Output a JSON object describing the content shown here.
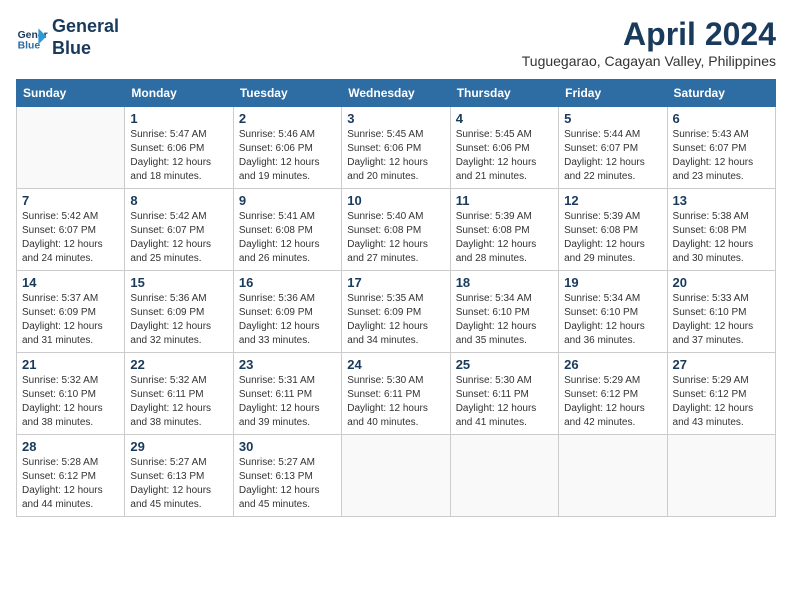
{
  "header": {
    "logo_line1": "General",
    "logo_line2": "Blue",
    "month_title": "April 2024",
    "location": "Tuguegarao, Cagayan Valley, Philippines"
  },
  "weekdays": [
    "Sunday",
    "Monday",
    "Tuesday",
    "Wednesday",
    "Thursday",
    "Friday",
    "Saturday"
  ],
  "weeks": [
    [
      {
        "day": "",
        "info": ""
      },
      {
        "day": "1",
        "info": "Sunrise: 5:47 AM\nSunset: 6:06 PM\nDaylight: 12 hours\nand 18 minutes."
      },
      {
        "day": "2",
        "info": "Sunrise: 5:46 AM\nSunset: 6:06 PM\nDaylight: 12 hours\nand 19 minutes."
      },
      {
        "day": "3",
        "info": "Sunrise: 5:45 AM\nSunset: 6:06 PM\nDaylight: 12 hours\nand 20 minutes."
      },
      {
        "day": "4",
        "info": "Sunrise: 5:45 AM\nSunset: 6:06 PM\nDaylight: 12 hours\nand 21 minutes."
      },
      {
        "day": "5",
        "info": "Sunrise: 5:44 AM\nSunset: 6:07 PM\nDaylight: 12 hours\nand 22 minutes."
      },
      {
        "day": "6",
        "info": "Sunrise: 5:43 AM\nSunset: 6:07 PM\nDaylight: 12 hours\nand 23 minutes."
      }
    ],
    [
      {
        "day": "7",
        "info": "Sunrise: 5:42 AM\nSunset: 6:07 PM\nDaylight: 12 hours\nand 24 minutes."
      },
      {
        "day": "8",
        "info": "Sunrise: 5:42 AM\nSunset: 6:07 PM\nDaylight: 12 hours\nand 25 minutes."
      },
      {
        "day": "9",
        "info": "Sunrise: 5:41 AM\nSunset: 6:08 PM\nDaylight: 12 hours\nand 26 minutes."
      },
      {
        "day": "10",
        "info": "Sunrise: 5:40 AM\nSunset: 6:08 PM\nDaylight: 12 hours\nand 27 minutes."
      },
      {
        "day": "11",
        "info": "Sunrise: 5:39 AM\nSunset: 6:08 PM\nDaylight: 12 hours\nand 28 minutes."
      },
      {
        "day": "12",
        "info": "Sunrise: 5:39 AM\nSunset: 6:08 PM\nDaylight: 12 hours\nand 29 minutes."
      },
      {
        "day": "13",
        "info": "Sunrise: 5:38 AM\nSunset: 6:08 PM\nDaylight: 12 hours\nand 30 minutes."
      }
    ],
    [
      {
        "day": "14",
        "info": "Sunrise: 5:37 AM\nSunset: 6:09 PM\nDaylight: 12 hours\nand 31 minutes."
      },
      {
        "day": "15",
        "info": "Sunrise: 5:36 AM\nSunset: 6:09 PM\nDaylight: 12 hours\nand 32 minutes."
      },
      {
        "day": "16",
        "info": "Sunrise: 5:36 AM\nSunset: 6:09 PM\nDaylight: 12 hours\nand 33 minutes."
      },
      {
        "day": "17",
        "info": "Sunrise: 5:35 AM\nSunset: 6:09 PM\nDaylight: 12 hours\nand 34 minutes."
      },
      {
        "day": "18",
        "info": "Sunrise: 5:34 AM\nSunset: 6:10 PM\nDaylight: 12 hours\nand 35 minutes."
      },
      {
        "day": "19",
        "info": "Sunrise: 5:34 AM\nSunset: 6:10 PM\nDaylight: 12 hours\nand 36 minutes."
      },
      {
        "day": "20",
        "info": "Sunrise: 5:33 AM\nSunset: 6:10 PM\nDaylight: 12 hours\nand 37 minutes."
      }
    ],
    [
      {
        "day": "21",
        "info": "Sunrise: 5:32 AM\nSunset: 6:10 PM\nDaylight: 12 hours\nand 38 minutes."
      },
      {
        "day": "22",
        "info": "Sunrise: 5:32 AM\nSunset: 6:11 PM\nDaylight: 12 hours\nand 38 minutes."
      },
      {
        "day": "23",
        "info": "Sunrise: 5:31 AM\nSunset: 6:11 PM\nDaylight: 12 hours\nand 39 minutes."
      },
      {
        "day": "24",
        "info": "Sunrise: 5:30 AM\nSunset: 6:11 PM\nDaylight: 12 hours\nand 40 minutes."
      },
      {
        "day": "25",
        "info": "Sunrise: 5:30 AM\nSunset: 6:11 PM\nDaylight: 12 hours\nand 41 minutes."
      },
      {
        "day": "26",
        "info": "Sunrise: 5:29 AM\nSunset: 6:12 PM\nDaylight: 12 hours\nand 42 minutes."
      },
      {
        "day": "27",
        "info": "Sunrise: 5:29 AM\nSunset: 6:12 PM\nDaylight: 12 hours\nand 43 minutes."
      }
    ],
    [
      {
        "day": "28",
        "info": "Sunrise: 5:28 AM\nSunset: 6:12 PM\nDaylight: 12 hours\nand 44 minutes."
      },
      {
        "day": "29",
        "info": "Sunrise: 5:27 AM\nSunset: 6:13 PM\nDaylight: 12 hours\nand 45 minutes."
      },
      {
        "day": "30",
        "info": "Sunrise: 5:27 AM\nSunset: 6:13 PM\nDaylight: 12 hours\nand 45 minutes."
      },
      {
        "day": "",
        "info": ""
      },
      {
        "day": "",
        "info": ""
      },
      {
        "day": "",
        "info": ""
      },
      {
        "day": "",
        "info": ""
      }
    ]
  ]
}
